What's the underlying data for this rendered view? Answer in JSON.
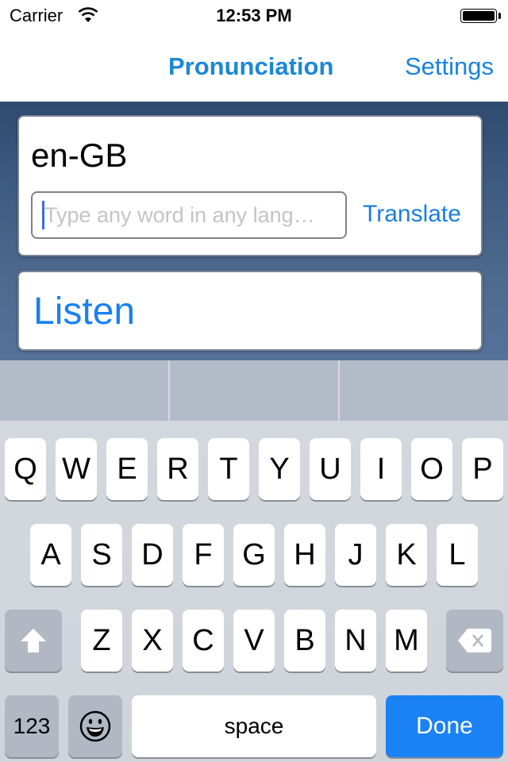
{
  "status_bar": {
    "carrier": "Carrier",
    "time": "12:53 PM",
    "wifi_icon": "wifi-icon",
    "battery_icon": "battery-full-icon"
  },
  "nav": {
    "title": "Pronunciation",
    "settings_label": "Settings"
  },
  "language_card": {
    "language_code": "en-GB",
    "input_value": "",
    "input_placeholder": "Type any word in any lang…",
    "translate_label": "Translate"
  },
  "listen_card": {
    "label": "Listen"
  },
  "keyboard": {
    "row1": [
      "Q",
      "W",
      "E",
      "R",
      "T",
      "Y",
      "U",
      "I",
      "O",
      "P"
    ],
    "row2": [
      "A",
      "S",
      "D",
      "F",
      "G",
      "H",
      "J",
      "K",
      "L"
    ],
    "row3": [
      "Z",
      "X",
      "C",
      "V",
      "B",
      "N",
      "M"
    ],
    "shift_icon": "shift-icon",
    "delete_icon": "delete-icon",
    "numbers_label": "123",
    "emoji_icon": "emoji-icon",
    "space_label": "space",
    "done_label": "Done"
  },
  "colors": {
    "accent": "#1a82f5",
    "nav_title": "#1c88d4",
    "background_top": "#2f4a6e"
  }
}
